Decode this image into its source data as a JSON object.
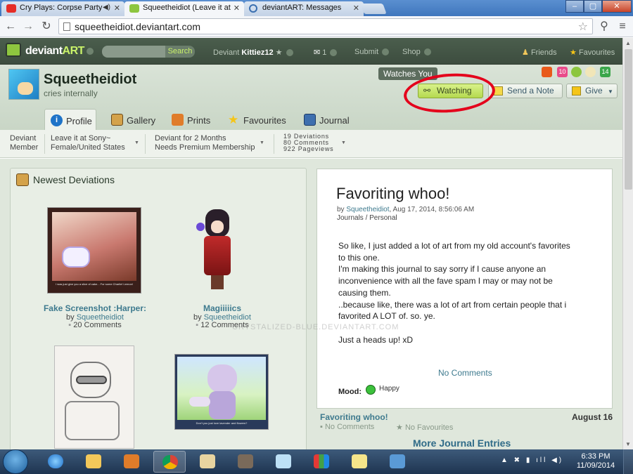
{
  "browser": {
    "tabs": [
      {
        "label": "Cry Plays: Corpse Party",
        "favicon_color": "#e52d27",
        "state": "inactive"
      },
      {
        "label": "Squeetheidiot (Leave it at",
        "favicon_color": "#8ec63f",
        "state": "active"
      },
      {
        "label": "deviantART: Messages",
        "favicon_color": "#3a6fb0",
        "state": "inactive"
      }
    ],
    "url": "squeetheidiot.deviantart.com",
    "window_buttons": [
      "–",
      "▢",
      "✕"
    ]
  },
  "da_header": {
    "logo_text_a": "deviant",
    "logo_text_b": "ART",
    "search_label": "Search",
    "deviant_label": "Deviant",
    "deviant_user": "Kittiez12",
    "messages_count": "1",
    "submit_label": "Submit",
    "shop_label": "Shop",
    "friends_label": "Friends",
    "favourites_label": "Favourites"
  },
  "profile": {
    "username": "Squeetheidiot",
    "tagline": "cries internally",
    "watches_you": "Watches You",
    "watching_label": "Watching",
    "send_note_label": "Send a Note",
    "give_label": "Give",
    "badges": [
      "#e85a1b",
      "#e94b8a",
      "#8cc63f",
      "#f1e6b8",
      "#3aa64a"
    ],
    "badge_numbers": {
      "b1": "10",
      "b4": "14"
    },
    "tabs": [
      {
        "label": "Profile",
        "icon_color": "#1e73c8"
      },
      {
        "label": "Gallery",
        "icon_color": "#d4a24a"
      },
      {
        "label": "Prints",
        "icon_color": "#e07c2a"
      },
      {
        "label": "Favourites",
        "icon_color": "#f5c518"
      },
      {
        "label": "Journal",
        "icon_color": "#3e6fae"
      }
    ]
  },
  "info_bar": {
    "member_type_1": "Deviant",
    "member_type_2": "Member",
    "leave_it": "Leave it at Sony~",
    "location": "Female/United States",
    "membership_duration": "Deviant for 2 Months",
    "membership_need": "Needs Premium Membership",
    "stat_deviations": "19 Deviations",
    "stat_comments": "80 Comments",
    "stat_pageviews": "922 Pageviews"
  },
  "newest": {
    "heading": "Newest Deviations",
    "items": [
      {
        "title": "Fake Screenshot :Harper:",
        "by": "by",
        "author": "Squeetheidiot",
        "comments": "20 Comments",
        "caption": "I was just give you a slice of cake... For some Charlie! Lemon!"
      },
      {
        "title": "Magiiiiics",
        "by": "by",
        "author": "Squeetheidiot",
        "comments": "12 Comments"
      },
      {
        "title": "",
        "by": "",
        "author": "",
        "comments": ""
      },
      {
        "title": "",
        "by": "",
        "author": "",
        "comments": "",
        "caption": "Don't you just love lavender and flowers?"
      }
    ]
  },
  "journal": {
    "title": "Favoriting whoo!",
    "meta_by": "by",
    "meta_author": "Squeetheidiot",
    "meta_date": ", Aug 17, 2014, 8:56:06 AM",
    "category": "Journals / Personal",
    "body": "So like, I just added a lot of art from my old account's favorites\nto this one.\nI'm making this journal to say sorry if I cause anyone an\ninconvenience with all the fave spam I may or may not be\ncausing them.\n..because like, there was a lot of art from certain people that i\nfavorited A LOT of. so. ye.\n\nJust a heads up! xD",
    "no_comments": "No Comments",
    "mood_label": "Mood:",
    "mood_value": "Happy",
    "footer_title": "Favoriting whoo!",
    "footer_date": "August 16",
    "footer_comments": "No Comments",
    "footer_favs": "No Favourites",
    "more_entries": "More Journal Entries"
  },
  "watermark": "CRYSTALIZED-BLUE.DEVIANTART.COM",
  "taskbar": {
    "clock_time": "6:33 PM",
    "clock_date": "11/09/2014",
    "tray": "▲ ✖ ▮ ıll ◀)"
  }
}
